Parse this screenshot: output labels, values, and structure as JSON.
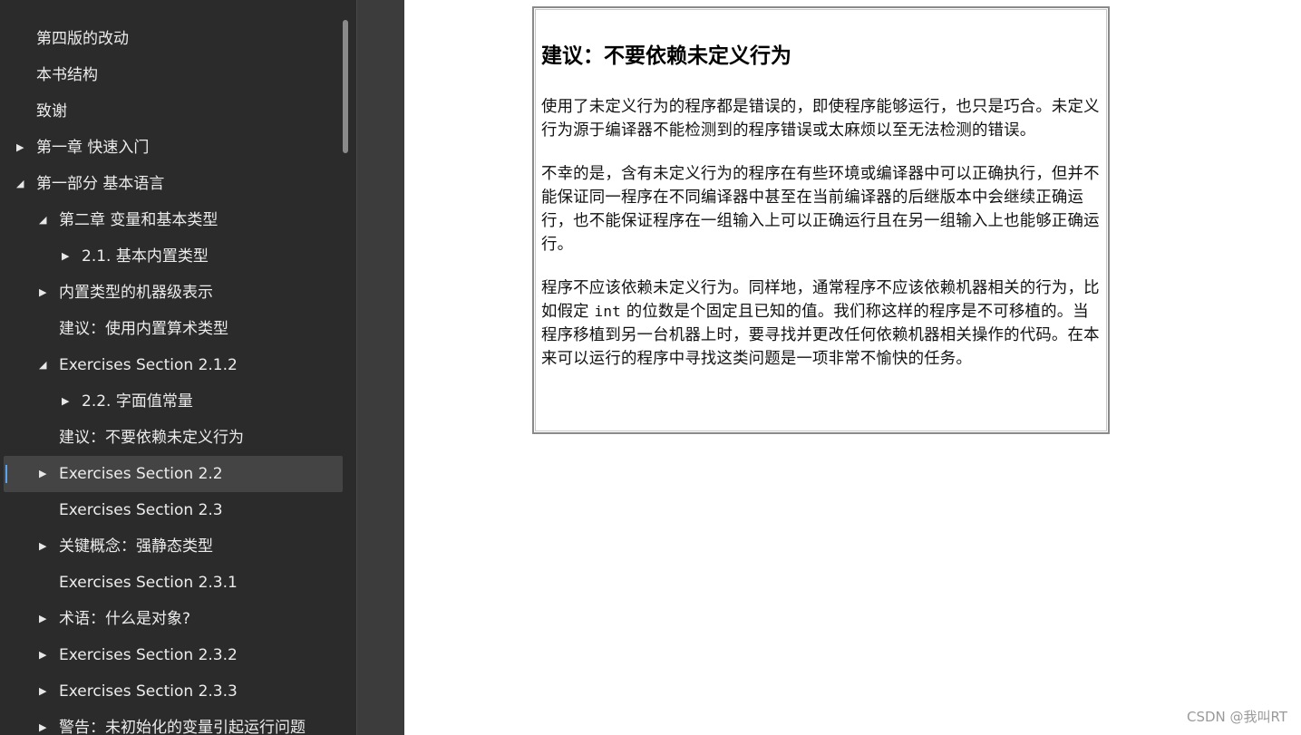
{
  "sidebar": {
    "items": [
      {
        "label": "第四版的改动",
        "expander": ""
      },
      {
        "label": "本书结构",
        "expander": ""
      },
      {
        "label": "致谢",
        "expander": ""
      },
      {
        "label": "第一章 快速入门",
        "expander": "▶"
      },
      {
        "label": "第一部分 基本语言",
        "expander": "◢"
      },
      {
        "label": "第二章 变量和基本类型",
        "expander": "◢"
      },
      {
        "label": "2.1. 基本内置类型",
        "expander": "▶"
      },
      {
        "label": "内置类型的机器级表示",
        "expander": "▶"
      },
      {
        "label": "建议：使用内置算术类型",
        "expander": ""
      },
      {
        "label": "Exercises Section 2.1.2",
        "expander": "◢"
      },
      {
        "label": "2.2. 字面值常量",
        "expander": "▶"
      },
      {
        "label": "建议：不要依赖未定义行为",
        "expander": ""
      },
      {
        "label": "Exercises Section 2.2",
        "expander": "▶"
      },
      {
        "label": "Exercises Section 2.3",
        "expander": ""
      },
      {
        "label": "关键概念：强静态类型",
        "expander": "▶"
      },
      {
        "label": "Exercises Section 2.3.1",
        "expander": ""
      },
      {
        "label": "术语：什么是对象?",
        "expander": "▶"
      },
      {
        "label": "Exercises Section 2.3.2",
        "expander": "▶"
      },
      {
        "label": "Exercises Section 2.3.3",
        "expander": "▶"
      },
      {
        "label": "警告：未初始化的变量引起运行问题",
        "expander": "▶"
      }
    ]
  },
  "content": {
    "title": "建议：不要依赖未定义行为",
    "p1": "使用了未定义行为的程序都是错误的，即使程序能够运行，也只是巧合。未定义行为源于编译器不能检测到的程序错误或太麻烦以至无法检测的错误。",
    "p2": "不幸的是，含有未定义行为的程序在有些环境或编译器中可以正确执行，但并不能保证同一程序在不同编译器中甚至在当前编译器的后继版本中会继续正确运行，也不能保证程序在一组输入上可以正确运行且在另一组输入上也能够正确运行。",
    "p3_before": "程序不应该依赖未定义行为。同样地，通常程序不应该依赖机器相关的行为，比如假定 ",
    "p3_code": "int",
    "p3_after": " 的位数是个固定且已知的值。我们称这样的程序是不可移植的。当程序移植到另一台机器上时，要寻找并更改任何依赖机器相关操作的代码。在本来可以运行的程序中寻找这类问题是一项非常不愉快的任务。"
  },
  "watermark": "CSDN @我叫RT",
  "colors": {
    "sidebar_bg": "#2b2b2b",
    "selected_bg": "#444444",
    "selected_accent": "#5aa3f0",
    "gap_bg": "#3c3c3c"
  }
}
